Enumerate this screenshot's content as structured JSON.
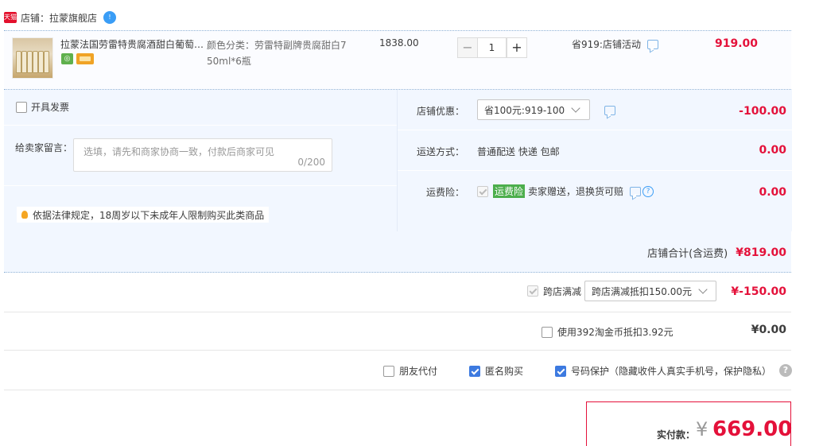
{
  "shop": {
    "badge": "天猫",
    "label": "店铺：拉蒙旗舰店",
    "ww_badge": "!"
  },
  "item": {
    "title": "拉蒙法国劳雷特贵腐酒甜白葡萄…",
    "sku_line1": "颜色分类：劳雷特副牌贵腐甜白7",
    "sku_line2": "50ml*6瓶",
    "unit_price": "1838.00",
    "qty": "1",
    "minus": "−",
    "plus": "+",
    "promo": "省919:店铺活动",
    "total": "919.00"
  },
  "invoice": {
    "label": "开具发票"
  },
  "message": {
    "label": "给卖家留言：",
    "placeholder": "选填，请先和商家协商一致，付款后商家可见",
    "count": "0/200"
  },
  "law_note": "依据法律规定，18周岁以下未成年人限制购买此类商品",
  "shop_discount": {
    "label": "店铺优惠：",
    "selected": "省100元:919-100",
    "amount": "-100.00"
  },
  "shipping": {
    "label": "运送方式：",
    "value": "普通配送 快递 包邮",
    "amount": "0.00"
  },
  "insurance": {
    "label": "运费险：",
    "tag": "运费险",
    "text": "卖家赠送，退换货可赔",
    "amount": "0.00"
  },
  "subtotal": {
    "label": "店铺合计(含运费)",
    "amount": "¥819.00"
  },
  "cross_store": {
    "label": "跨店满减",
    "selected": "跨店满减抵扣150.00元",
    "amount": "¥-150.00"
  },
  "coins": {
    "label": "使用392淘金币抵扣3.92元",
    "amount": "¥0.00"
  },
  "options": {
    "friend_pay": "朋友代付",
    "anonymous": "匿名购买",
    "number_protect": "号码保护（隐藏收件人真实手机号，保护隐私）"
  },
  "pay": {
    "label": "实付款：",
    "yen": "¥",
    "amount": "669.00"
  },
  "colors": {
    "price_red": "#e4113a",
    "panel_bg": "#f2f7ff",
    "check_blue": "#3d7ae0"
  }
}
